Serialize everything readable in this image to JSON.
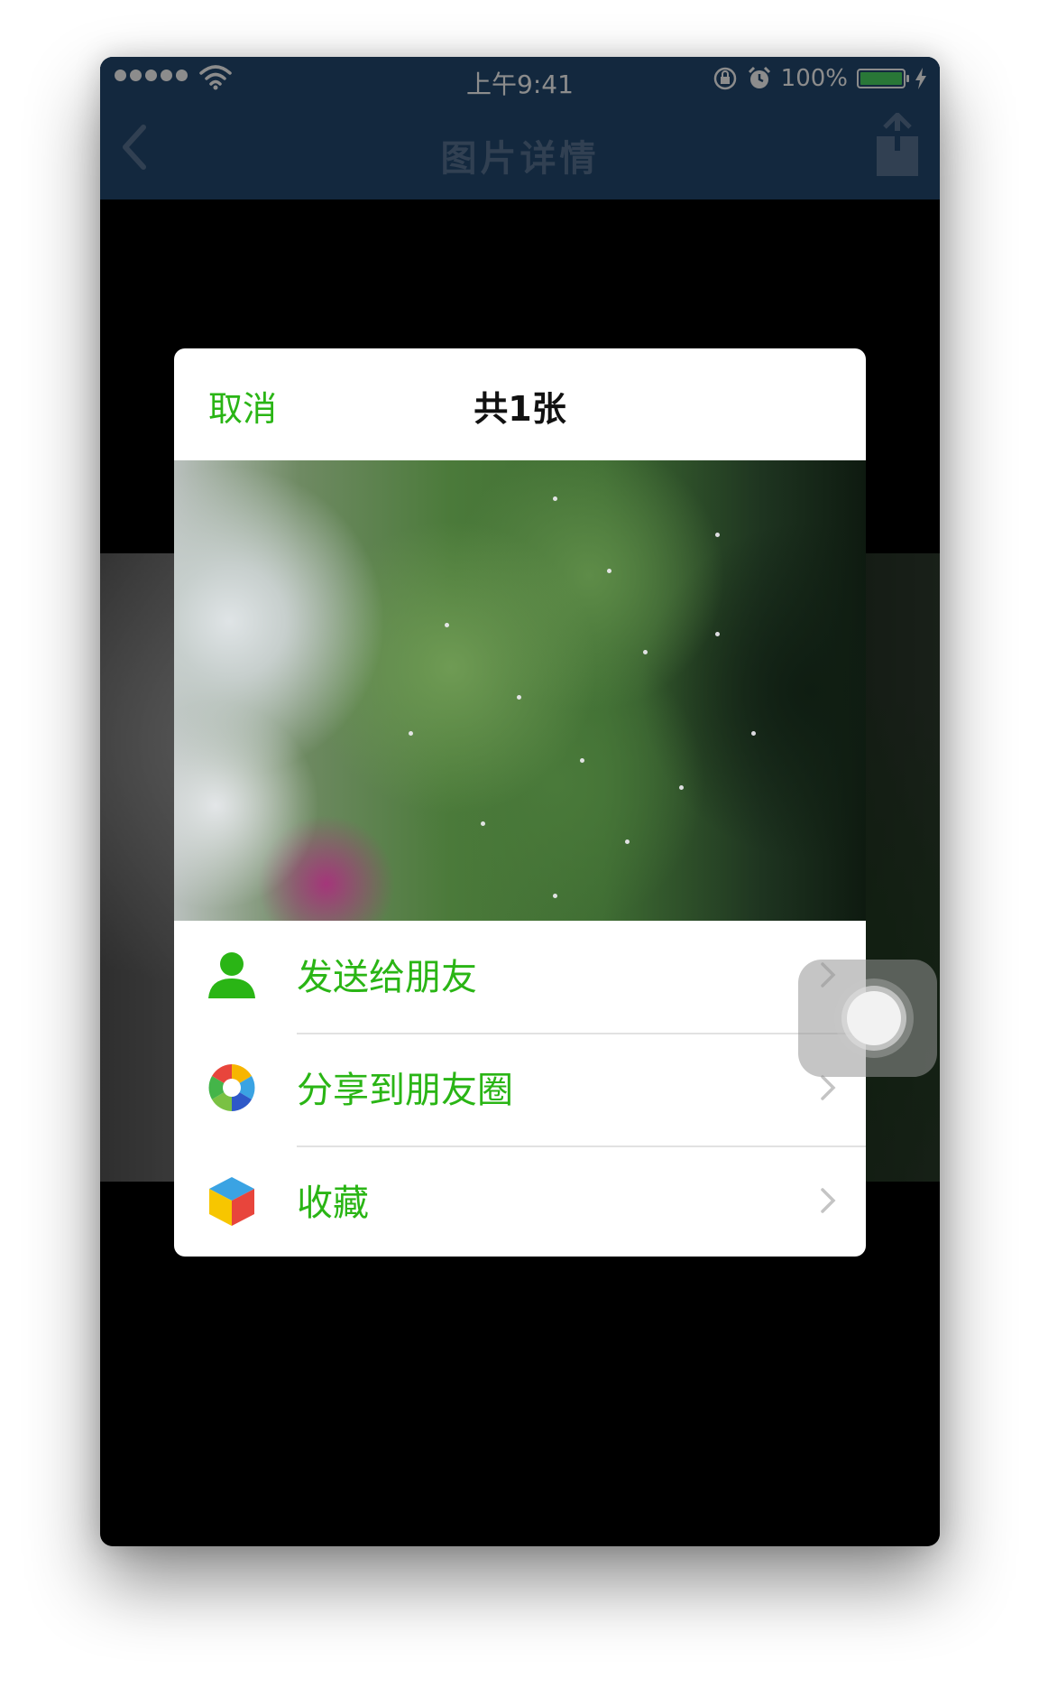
{
  "status_bar": {
    "time": "上午9:41",
    "battery": "100%"
  },
  "navbar": {
    "title": "图片详情"
  },
  "sheet": {
    "cancel_label": "取消",
    "count_label": "共1张",
    "actions": [
      {
        "label": "发送给朋友",
        "icon": "person-icon"
      },
      {
        "label": "分享到朋友圈",
        "icon": "moments-icon"
      },
      {
        "label": "收藏",
        "icon": "favorites-cube-icon"
      }
    ]
  },
  "colors": {
    "navbar_bg": "#234a72",
    "accent_green": "#2ab515",
    "battery_green": "#4cd964"
  }
}
